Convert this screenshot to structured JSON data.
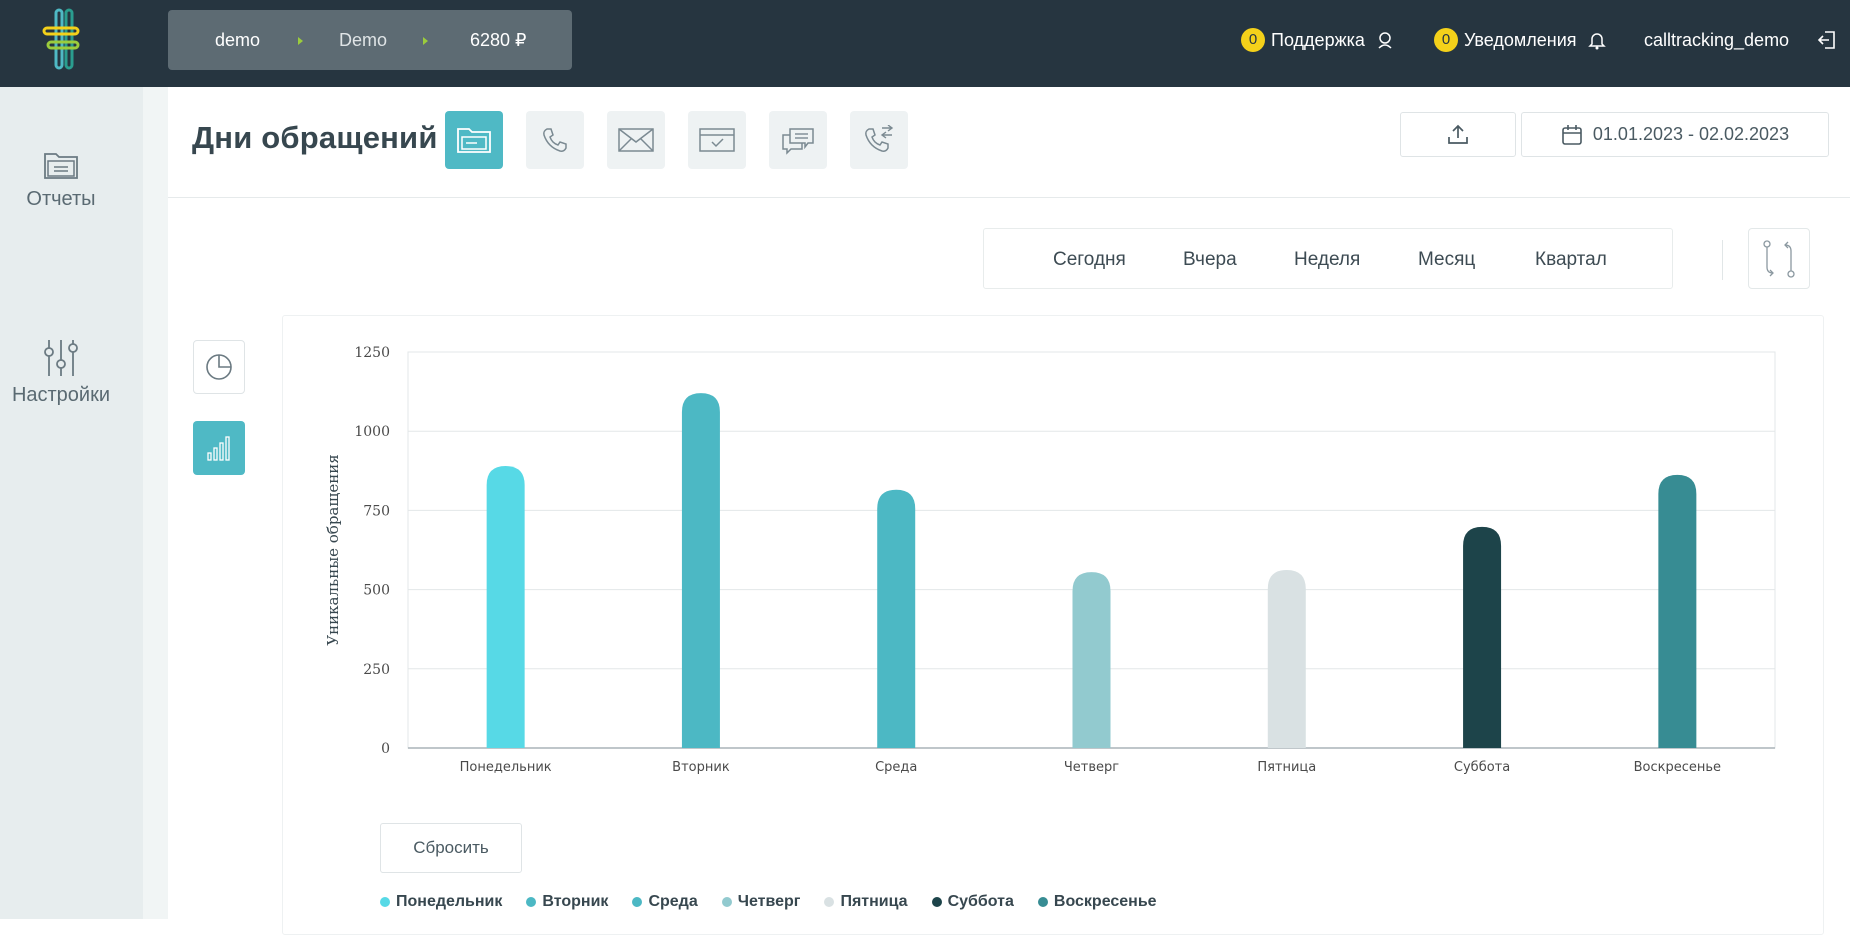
{
  "account": {
    "login": "demo",
    "project": "Demo",
    "balance": "6280 ₽"
  },
  "topbar": {
    "support": {
      "count": "0",
      "label": "Поддержка"
    },
    "notifications": {
      "count": "0",
      "label": "Уведомления"
    },
    "user": "calltracking_demo"
  },
  "sidebar": {
    "reports_label": "Отчеты",
    "settings_label": "Настройки"
  },
  "page": {
    "title": "Дни обращений"
  },
  "date_range": "01.01.2023 - 02.02.2023",
  "periods": [
    "Сегодня",
    "Вчера",
    "Неделя",
    "Месяц",
    "Квартал"
  ],
  "reset_label": "Сбросить",
  "colors": {
    "accent": "#4fb9c5",
    "topbar": "#263540",
    "badge": "#f4d11a"
  },
  "chart_data": {
    "type": "bar",
    "ylabel": "Уникальные обращения",
    "ylim": [
      0,
      1250
    ],
    "yticks": [
      0,
      250,
      500,
      750,
      1000,
      1250
    ],
    "grid": true,
    "categories": [
      "Понедельник",
      "Вторник",
      "Среда",
      "Четверг",
      "Пятница",
      "Суббота",
      "Воскресенье"
    ],
    "values": [
      890,
      1120,
      815,
      555,
      562,
      698,
      862
    ],
    "bar_colors": [
      "#57d9e6",
      "#4cb8c4",
      "#4cb8c4",
      "#92cacf",
      "#d9e1e3",
      "#1d444a",
      "#378c93"
    ],
    "legend_position": "bottom-left"
  }
}
